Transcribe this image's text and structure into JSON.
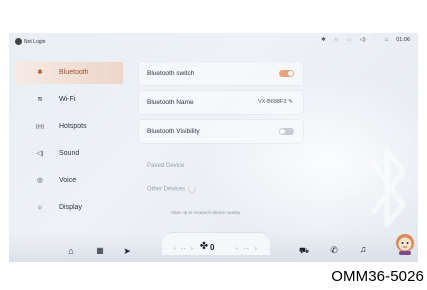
{
  "status": {
    "user": "Not Login",
    "time": "01:06"
  },
  "sidebar": {
    "items": [
      {
        "label": "Bluetooth",
        "icon": "bluetooth-icon",
        "glyph": "✱"
      },
      {
        "label": "Wi-Fi",
        "icon": "wifi-icon",
        "glyph": "≋"
      },
      {
        "label": "Hotspots",
        "icon": "hotspot-icon",
        "glyph": "((•))"
      },
      {
        "label": "Sound",
        "icon": "speaker-icon",
        "glyph": "◁)"
      },
      {
        "label": "Voice",
        "icon": "voice-icon",
        "glyph": "◎"
      },
      {
        "label": "Display",
        "icon": "brightness-icon",
        "glyph": "☼"
      }
    ]
  },
  "bluetooth": {
    "switch_label": "Bluetooth switch",
    "switch_on": true,
    "name_label": "Bluetooth Name",
    "name_value": "VX-B688F3",
    "visibility_label": "Bluetooth Visibility",
    "visibility_on": false,
    "paired_label": "Paired Device",
    "other_label": "Other Devices",
    "hint": "Slide up to research device nearby"
  },
  "dock": {
    "left_temp": "- -",
    "fan_level": "0",
    "right_temp": "- -"
  },
  "code": "OMM36-5026",
  "colors": {
    "accent": "#e9a27f",
    "active_text": "#a5502e"
  }
}
